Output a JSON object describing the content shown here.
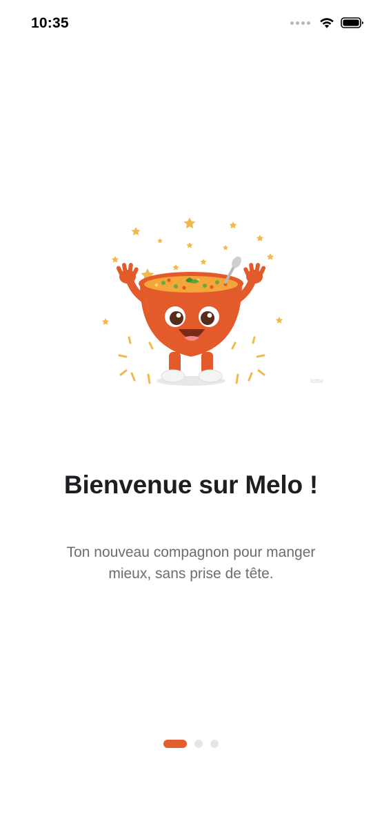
{
  "status_bar": {
    "time": "10:35",
    "wifi_icon": "wifi-icon",
    "battery_icon": "battery-icon"
  },
  "illustration": {
    "icon": "soup-bowl-mascot-icon",
    "watermark": "lottie"
  },
  "onboarding": {
    "title": "Bienvenue sur Melo !",
    "subtitle": "Ton nouveau compagnon pour manger mieux, sans prise de tête."
  },
  "pager": {
    "pages": 3,
    "active_index": 0,
    "active_color": "#e2602e",
    "inactive_color": "#e6e6e9"
  }
}
